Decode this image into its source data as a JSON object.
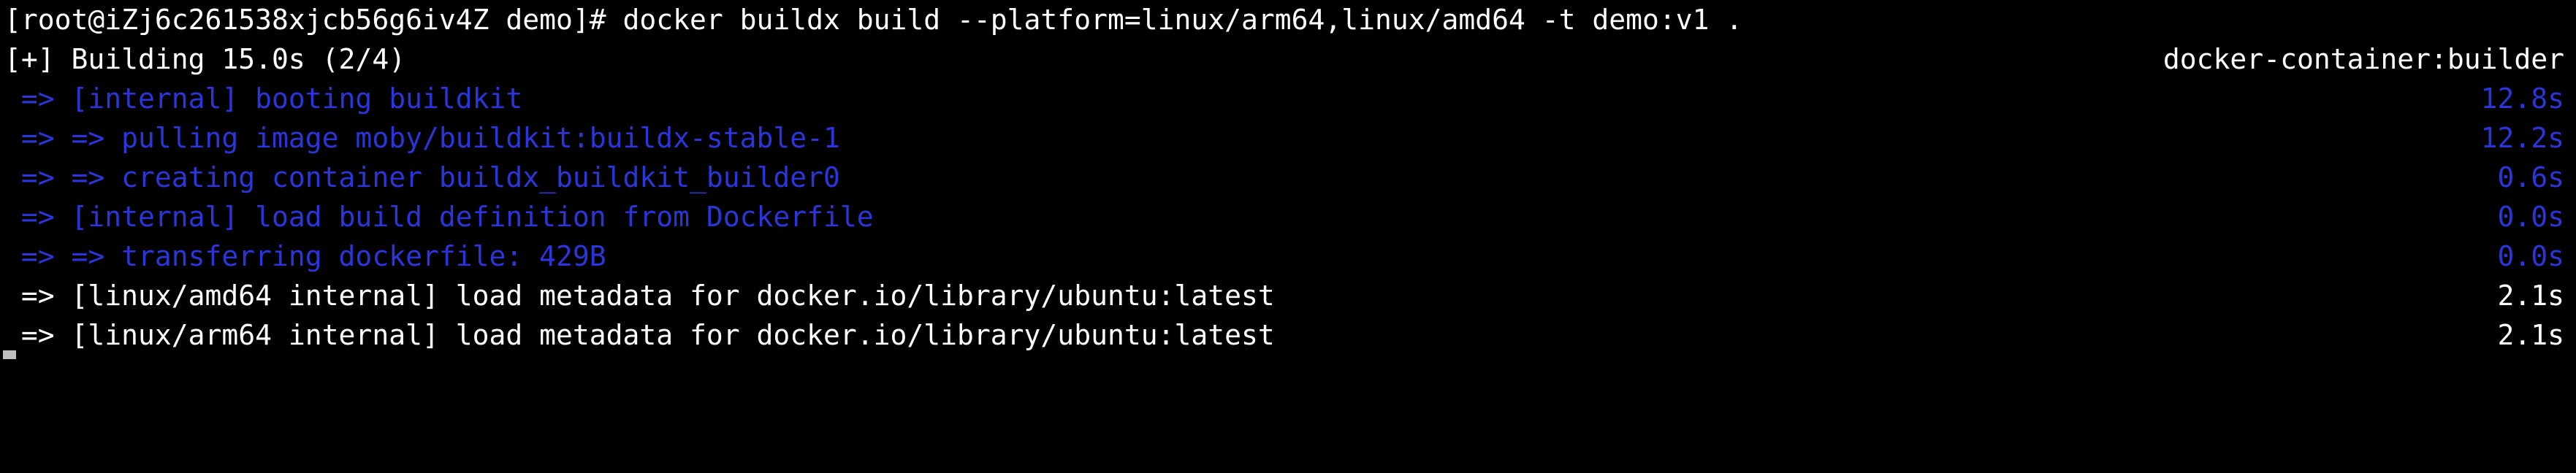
{
  "terminal": {
    "prompt": "[root@iZj6c261538xjcb56g6iv4Z demo]# docker buildx build --platform=linux/arm64,linux/amd64 -t demo:v1 .",
    "status": {
      "text": "[+] Building 15.0s (2/4)",
      "builder": "docker-container:builder"
    },
    "steps": [
      {
        "text": " => [internal] booting buildkit",
        "time": "12.8s",
        "state": "done"
      },
      {
        "text": " => => pulling image moby/buildkit:buildx-stable-1",
        "time": "12.2s",
        "state": "done"
      },
      {
        "text": " => => creating container buildx_buildkit_builder0",
        "time": "0.6s",
        "state": "done"
      },
      {
        "text": " => [internal] load build definition from Dockerfile",
        "time": "0.0s",
        "state": "done"
      },
      {
        "text": " => => transferring dockerfile: 429B",
        "time": "0.0s",
        "state": "done"
      },
      {
        "text": " => [linux/amd64 internal] load metadata for docker.io/library/ubuntu:latest",
        "time": "2.1s",
        "state": "running"
      },
      {
        "text": " => [linux/arm64 internal] load metadata for docker.io/library/ubuntu:latest",
        "time": "2.1s",
        "state": "running"
      }
    ],
    "colors": {
      "background": "#000000",
      "text": "#ffffff",
      "done": "#2b35d8"
    }
  }
}
